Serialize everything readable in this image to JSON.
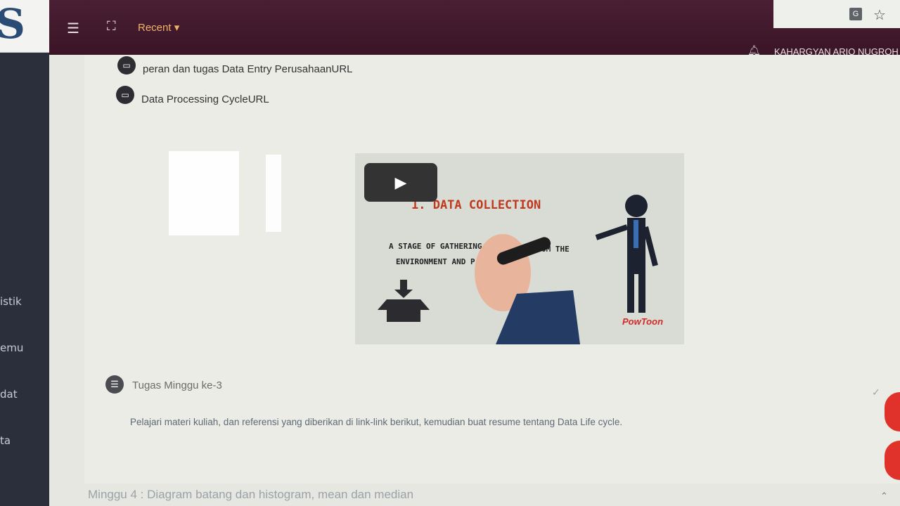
{
  "topbar": {
    "recent_label": "Recent ▾",
    "user_name": "KAHARGYAN ARIO NUGROH"
  },
  "sidebar": {
    "items": [
      {
        "label": "istik"
      },
      {
        "label": "emu"
      },
      {
        "label": "dat"
      },
      {
        "label": "ta"
      }
    ]
  },
  "content": {
    "links": [
      {
        "label": "peran dan tugas Data Entry PerusahaanURL",
        "icon": "url-icon"
      },
      {
        "label": "Data Processing CycleURL",
        "icon": "url-icon"
      }
    ],
    "video": {
      "title": "1. DATA COLLECTION",
      "line1": "A STAGE OF GATHERING",
      "line1_tail": "OM THE",
      "line2": "ENVIRONMENT AND P",
      "brand": "PowToon"
    },
    "assignment": {
      "title": "Tugas Minggu ke-3",
      "description": "Pelajari materi kuliah, dan referensi yang diberikan di link-link berikut, kemudian buat resume tentang Data Life cycle."
    },
    "next_section": "Minggu 4 : Diagram batang dan histogram, mean dan median"
  },
  "colors": {
    "topbar": "#3f1a2b",
    "accent": "#f0b26a",
    "fab": "#e0322a"
  }
}
